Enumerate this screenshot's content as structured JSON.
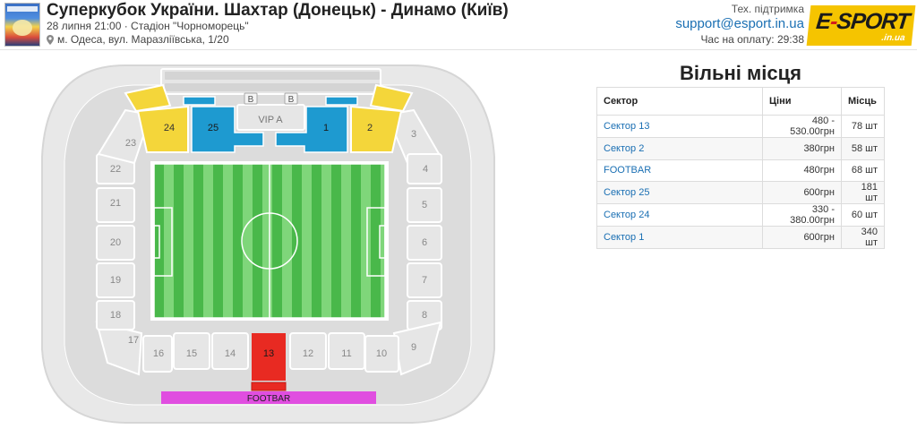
{
  "header": {
    "title": "Суперкубок України. Шахтар (Донецьк) - Динамо (Київ)",
    "datetime_venue": "28 липня 21:00 · Стадіон \"Чорноморець\"",
    "address": "м. Одеса, вул. Маразліївська, 1/20",
    "support_label": "Тех. підтримка",
    "support_email": "support@esport.in.ua",
    "payment_timer": "Час на оплату: 29:38",
    "logo_text": "E-SPORT",
    "logo_sub": ".in.ua"
  },
  "colors": {
    "available_blue": "#1e9ad0",
    "available_yellow": "#f4d63a",
    "selected_red": "#e82a22",
    "footbar_magenta": "#e04ee0",
    "unavailable": "#e5e5e5",
    "field_green_dark": "#49b84a",
    "field_green_light": "#7fd67a",
    "link_blue": "#1a6fb3"
  },
  "stadium": {
    "sectors": {
      "s1": "1",
      "s2": "2",
      "s3": "3",
      "s4": "4",
      "s5": "5",
      "s6": "6",
      "s7": "7",
      "s8": "8",
      "s9": "9",
      "s10": "10",
      "s11": "11",
      "s12": "12",
      "s13": "13",
      "s14": "14",
      "s15": "15",
      "s16": "16",
      "s17": "17",
      "s18": "18",
      "s19": "19",
      "s20": "20",
      "s21": "21",
      "s22": "22",
      "s23": "23",
      "s24": "24",
      "s25": "25"
    },
    "vip_label": "VIP A",
    "box_b_label": "B",
    "footbar_label": "FOOTBAR"
  },
  "panel": {
    "title": "Вільні місця",
    "columns": [
      "Сектор",
      "Ціни",
      "Місць"
    ],
    "rows": [
      {
        "sector": "Сектор 13",
        "price": "480 - 530.00грн",
        "count": "78 шт"
      },
      {
        "sector": "Сектор 2",
        "price": "380грн",
        "count": "58 шт"
      },
      {
        "sector": "FOOTBAR",
        "price": "480грн",
        "count": "68 шт"
      },
      {
        "sector": "Сектор 25",
        "price": "600грн",
        "count": "181 шт"
      },
      {
        "sector": "Сектор 24",
        "price": "330 - 380.00грн",
        "count": "60 шт"
      },
      {
        "sector": "Сектор 1",
        "price": "600грн",
        "count": "340 шт"
      }
    ]
  }
}
